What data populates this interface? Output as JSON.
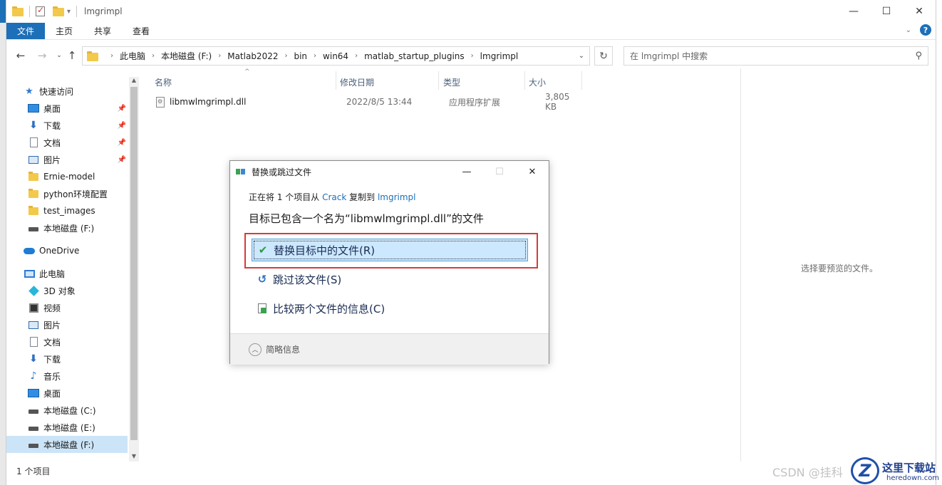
{
  "titlebar": {
    "title": "lmgrimpl",
    "minimize": "—",
    "maximize": "☐",
    "close": "✕"
  },
  "ribbon": {
    "tabs": [
      "文件",
      "主页",
      "共享",
      "查看"
    ],
    "help": "?"
  },
  "address": {
    "crumbs": [
      "此电脑",
      "本地磁盘 (F:)",
      "Matlab2022",
      "bin",
      "win64",
      "matlab_startup_plugins",
      "lmgrimpl"
    ],
    "search_placeholder": "在 lmgrimpl 中搜索"
  },
  "nav": {
    "items": [
      {
        "label": "快速访问",
        "icon": "star-icon"
      },
      {
        "label": "桌面",
        "icon": "desktop-icon",
        "pinned": true
      },
      {
        "label": "下载",
        "icon": "download-icon",
        "pinned": true
      },
      {
        "label": "文档",
        "icon": "document-icon",
        "pinned": true
      },
      {
        "label": "图片",
        "icon": "picture-icon",
        "pinned": true
      },
      {
        "label": "Ernie-model",
        "icon": "folder-icon"
      },
      {
        "label": "python环境配置",
        "icon": "folder-icon"
      },
      {
        "label": "test_images",
        "icon": "folder-icon"
      },
      {
        "label": "本地磁盘 (F:)",
        "icon": "drive-icon"
      },
      {
        "label": "OneDrive",
        "icon": "cloud-icon"
      },
      {
        "label": "此电脑",
        "icon": "pc-icon"
      },
      {
        "label": "3D 对象",
        "icon": "3d-object-icon"
      },
      {
        "label": "视频",
        "icon": "video-icon"
      },
      {
        "label": "图片",
        "icon": "picture-icon"
      },
      {
        "label": "文档",
        "icon": "document-icon"
      },
      {
        "label": "下载",
        "icon": "download-icon"
      },
      {
        "label": "音乐",
        "icon": "music-icon"
      },
      {
        "label": "桌面",
        "icon": "desktop-icon"
      },
      {
        "label": "本地磁盘 (C:)",
        "icon": "drive-icon"
      },
      {
        "label": "本地磁盘 (E:)",
        "icon": "drive-icon"
      },
      {
        "label": "本地磁盘 (F:)",
        "icon": "drive-icon",
        "selected": true
      }
    ]
  },
  "filelist": {
    "columns": [
      "名称",
      "修改日期",
      "类型",
      "大小"
    ],
    "rows": [
      {
        "name": "libmwlmgrimpl.dll",
        "modified": "2022/8/5 13:44",
        "type": "应用程序扩展",
        "size": "3,805 KB"
      }
    ]
  },
  "preview": {
    "message": "选择要预览的文件。"
  },
  "status": {
    "count": "1 个项目"
  },
  "dialog": {
    "title": "替换或跳过文件",
    "from_prefix": "正在将 1 个项目从 ",
    "from_source": "Crack",
    "from_middle": " 复制到 ",
    "from_dest": "lmgrimpl",
    "heading": "目标已包含一个名为“libmwlmgrimpl.dll”的文件",
    "options": {
      "replace": "替换目标中的文件(R)",
      "skip": "跳过该文件(S)",
      "compare": "比较两个文件的信息(C)"
    },
    "footer": "简略信息"
  },
  "watermark": {
    "csdn": "CSDN @挂科",
    "site_cn": "这里下载站",
    "site_en": "heredown.com",
    "logo_letter": "Z"
  },
  "colors": {
    "accent": "#1d6fb8",
    "highlight_border": "#d63a3a",
    "selected_option_bg": "#cce8ff"
  }
}
